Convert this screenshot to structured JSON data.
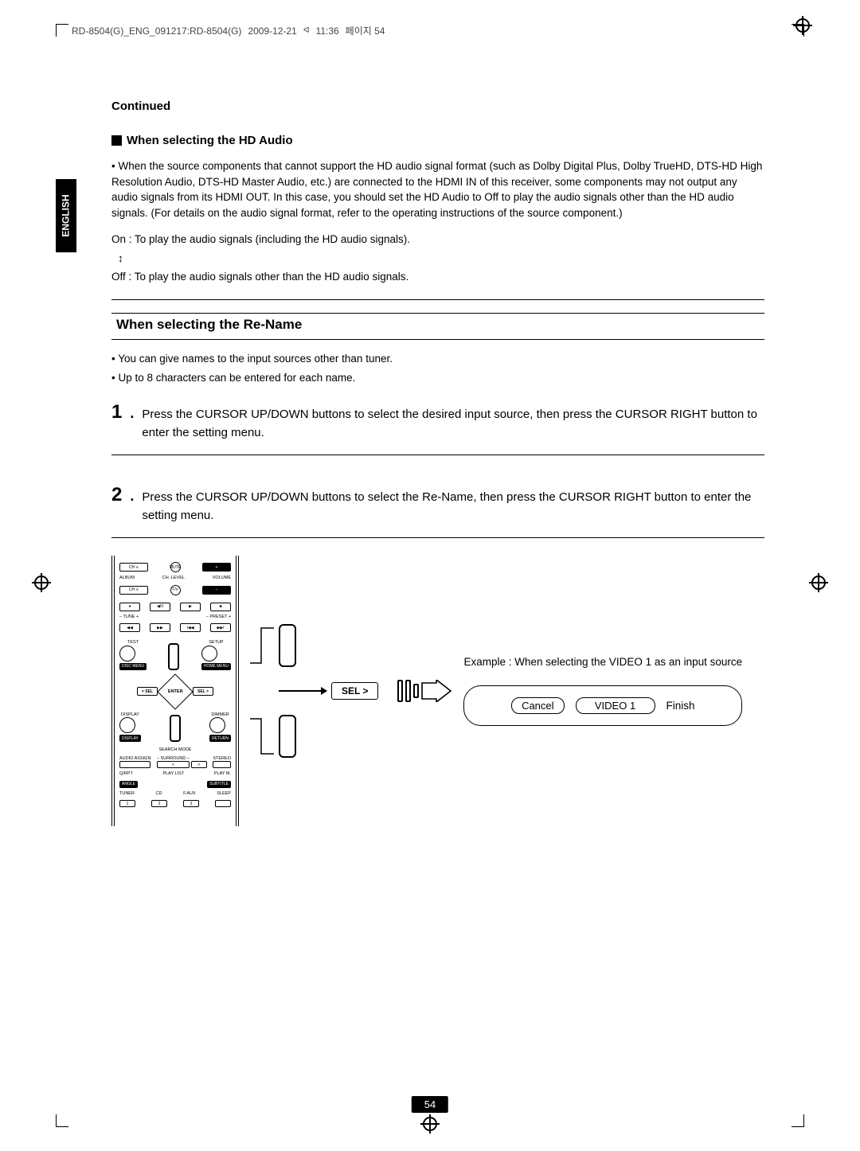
{
  "header": {
    "file": "RD-8504(G)_ENG_091217:RD-8504(G)",
    "date": "2009-12-21",
    "time": "11:36",
    "extra": "페이지 54"
  },
  "side": {
    "language": "ENGLISH"
  },
  "content": {
    "continued": "Continued",
    "hdAudio": {
      "heading": "When selecting the HD Audio",
      "p1": "• When the source components that cannot support the HD audio signal format (such as Dolby Digital Plus, Dolby TrueHD, DTS-HD High Resolution Audio, DTS-HD Master Audio, etc.) are connected to the HDMI IN of this receiver, some components may not output any audio signals from its HDMI OUT.\nIn this case, you should set the HD Audio to Off to play the audio signals other than the HD audio signals. (For details on the audio signal format, refer to the operating instructions of the source component.)",
      "on": "On : To play the audio signals (including the HD audio signals).",
      "arrow": "↕",
      "off": "Off : To play the audio signals other than the HD audio signals."
    },
    "rename": {
      "title": "When selecting the Re-Name",
      "b1": "• You can give names to the input sources other than tuner.",
      "b2": "• Up to 8 characters can be entered for each name."
    },
    "steps": [
      {
        "num": "1",
        "text": "Press the CURSOR UP/DOWN buttons to select the desired input source, then press the CURSOR RIGHT button to enter the setting menu."
      },
      {
        "num": "2",
        "text": "Press the CURSOR UP/DOWN buttons to select the Re-Name, then press the CURSOR RIGHT button to enter the setting menu."
      }
    ]
  },
  "remote": {
    "r1": {
      "a": "CH ∧",
      "b": "MUTE",
      "c": "+"
    },
    "r2": {
      "a": "ALBUM",
      "b": "CH. LEVEL",
      "c": "VOLUME"
    },
    "r3": {
      "a": "CH ∨",
      "b": "T/V",
      "c": "–"
    },
    "r5": {
      "a": "– TUNE +",
      "b": "– PRESET +"
    },
    "r7": {
      "a": "TEST",
      "b": "SETUP",
      "c": "DISC MENU",
      "d": "HOME MENU"
    },
    "r8": {
      "a": "< SEL",
      "b": "ENTER",
      "c": "SEL >"
    },
    "r9": {
      "a": "DISPLAY",
      "b": "DIMMER",
      "c": "DISPLAY",
      "d": "RETURN",
      "e": "SEARCH MODE"
    },
    "r10": {
      "a": "AUDIO ASSIGN",
      "b": "– SURROUND –",
      "c": "STEREO"
    },
    "r11": {
      "a": "Q/RPT",
      "b": "PLAY LIST",
      "c": "PLAY M."
    },
    "r12": {
      "a": "ANGLE",
      "b": "SUBTITLE"
    },
    "r13": {
      "a": "TUNER",
      "b": "CD",
      "c": "F.AUX",
      "d": "SLEEP"
    },
    "r14": {
      "a": "1",
      "b": "2",
      "c": "3"
    }
  },
  "diagram": {
    "sel": "SEL >",
    "example": "Example : When selecting the VIDEO 1 as an input source",
    "cancel": "Cancel",
    "video1": "VIDEO 1",
    "finish": "Finish"
  },
  "footer": {
    "page": "54"
  }
}
